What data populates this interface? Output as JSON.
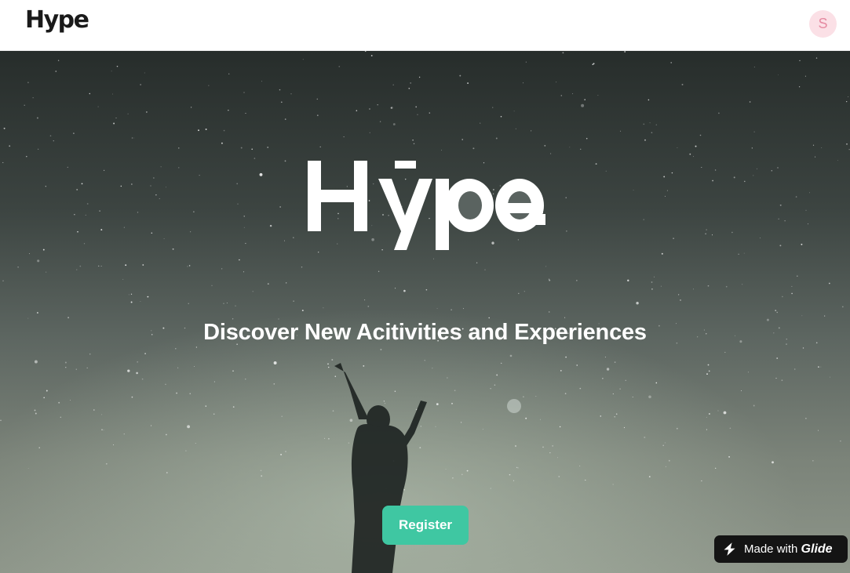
{
  "header": {
    "brand": "Hype",
    "avatar_initial": "S"
  },
  "hero": {
    "logo_text": "Hype",
    "tagline": "Discover New Acitivities and Experiences",
    "register_label": "Register"
  },
  "badge": {
    "prefix": "Made with",
    "brand": "Glide"
  },
  "colors": {
    "accent": "#3fc7a2",
    "avatar_bg": "#fbe0e6",
    "avatar_text": "#e58aa1",
    "badge_bg": "#141414"
  },
  "icons": {
    "avatar": "user-avatar-icon",
    "glide": "glide-bolt-icon"
  }
}
